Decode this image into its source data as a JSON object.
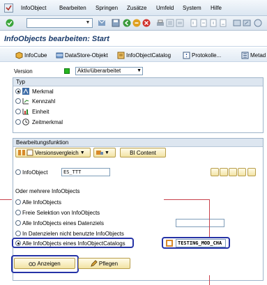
{
  "menubar": {
    "items": [
      "InfoObject",
      "Bearbeiten",
      "Springen",
      "Zusätze",
      "Umfeld",
      "System",
      "Hilfe"
    ]
  },
  "toolbar": {
    "command_field_value": ""
  },
  "screen": {
    "title": "InfoObjects bearbeiten: Start"
  },
  "app_toolbar": {
    "buttons": [
      "InfoCube",
      "DataStore-Objekt",
      "InfoObjectCatalog",
      "Protokolle...",
      "Metad"
    ]
  },
  "version": {
    "label": "Version",
    "selected": "Aktiv/überarbeitet"
  },
  "typ_group": {
    "title": "Typ",
    "options": [
      "Merkmal",
      "Kennzahl",
      "Einheit",
      "Zeitmerkmal"
    ],
    "selected_index": 0
  },
  "bearbeitung_group": {
    "title": "Bearbeitungsfunktion",
    "toolbar_buttons": [
      "Versionsvergleich",
      "BI Content"
    ],
    "infoobject_label": "InfoObject",
    "infoobject_value": "ES_TTT",
    "mehrere_label": "Oder mehrere InfoObjects",
    "options": [
      "Alle InfoObjects",
      "Freie Selektion von InfoObjects",
      "Alle InfoObjects eines Datenziels",
      "In Datenzielen nicht benutzte InfoObjects",
      "Alle InfoObjects eines InfoObjectCatalogs"
    ],
    "selected_option_index": 4,
    "datenziel_value": "",
    "catalog_value": "TESTING_MOD_CHA",
    "anzeigen_label": "Anzeigen",
    "pflegen_label": "Pflegen"
  },
  "colors": {
    "highlight": "#2533a6",
    "annotation_line": "#c8404b",
    "title": "#1a3b6b"
  }
}
